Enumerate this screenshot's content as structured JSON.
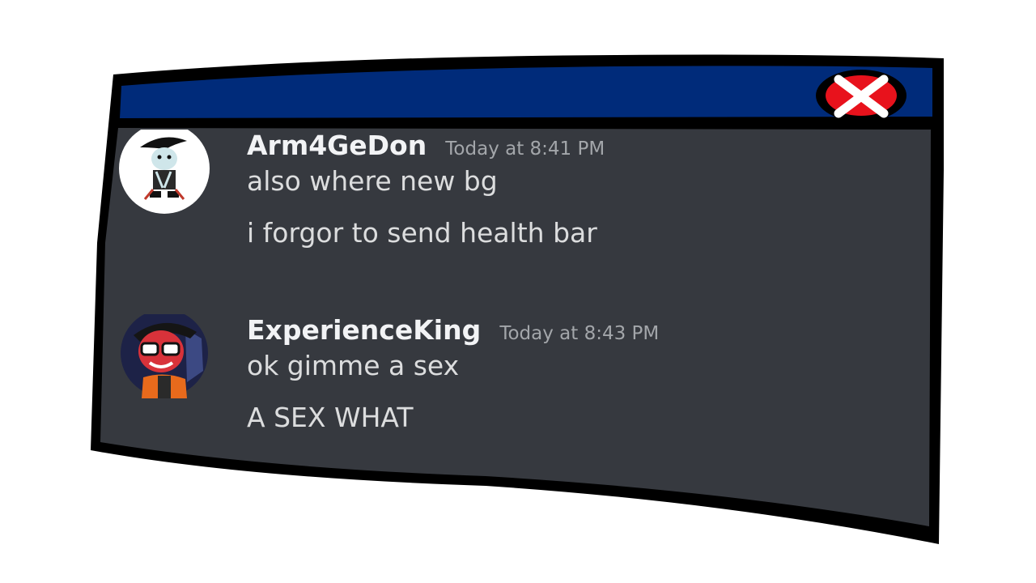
{
  "window": {
    "titlebar_color": "#002b7a",
    "body_color": "#36393f",
    "border_color": "#000000",
    "close_icon": "close-icon"
  },
  "messages": [
    {
      "username": "Arm4GeDon",
      "timestamp": "Today at 8:41 PM",
      "avatar_icon": "avatar-arm4gedon",
      "lines": [
        "also where new bg",
        "i forgor to send health bar"
      ]
    },
    {
      "username": "ExperienceKing",
      "timestamp": "Today at 8:43 PM",
      "avatar_icon": "avatar-experienceking",
      "lines": [
        "ok gimme a sex",
        "A SEX WHAT"
      ]
    }
  ]
}
